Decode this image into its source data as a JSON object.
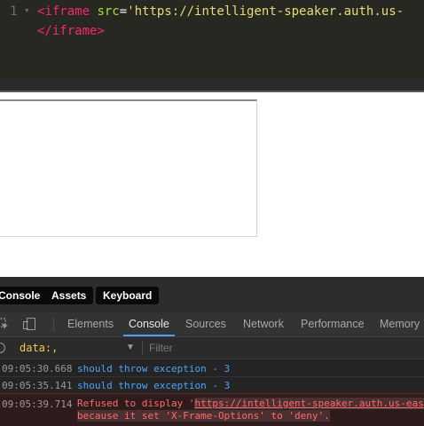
{
  "editor": {
    "line_number": "1",
    "fold_arrow": "▾",
    "line1": {
      "open_bracket": "<",
      "tag": "iframe",
      "attr": "src",
      "eq": "=",
      "value": "'https://intelligent-speaker.auth.us-"
    },
    "line2": {
      "close_tag": "</iframe>"
    }
  },
  "drawer": {
    "tabs": [
      {
        "label": "Console"
      },
      {
        "label": "Assets"
      },
      {
        "label": "Keyboard"
      }
    ]
  },
  "devtools": {
    "tabs": [
      {
        "label": "Elements"
      },
      {
        "label": "Console",
        "active": true
      },
      {
        "label": "Sources"
      },
      {
        "label": "Network"
      },
      {
        "label": "Performance"
      },
      {
        "label": "Memory"
      }
    ],
    "context": "data:,",
    "filter_placeholder": "Filter",
    "logs": [
      {
        "timestamp": "09:05:30.668",
        "message": "should throw exception - 3"
      },
      {
        "timestamp": "09:05:35.141",
        "message": "should throw exception - 3"
      }
    ],
    "error": {
      "timestamp": "09:05:39.714",
      "prefix": "Refused to display '",
      "url": "https://intelligent-speaker.auth.us-eas",
      "line2_prefix": "because it set ",
      "line2_highlight": "'X-Frame-Options' to 'deny'.",
      "color": "#ff6b6b"
    }
  },
  "colors": {
    "editor_bg": "#272822",
    "devtools_bg": "#242424",
    "accent": "#4b9dfb",
    "log_blue": "#4fa3f7",
    "context_yellow": "#f2c84b"
  }
}
